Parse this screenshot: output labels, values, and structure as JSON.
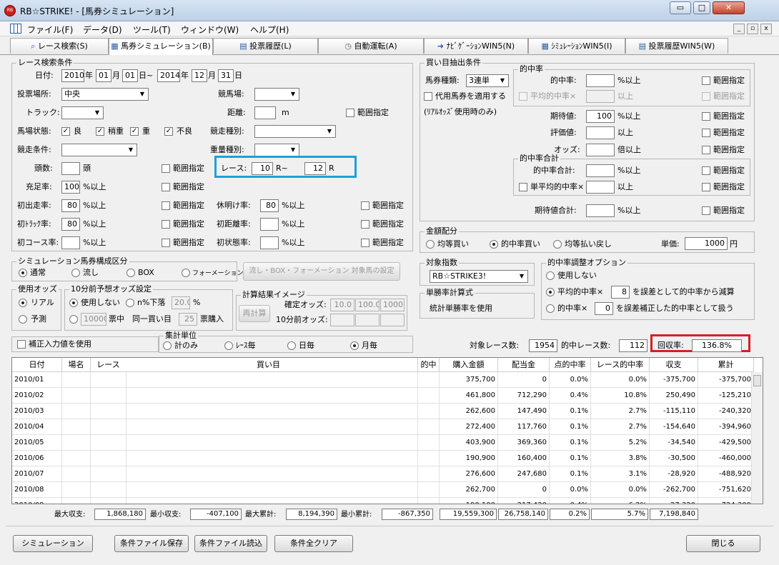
{
  "window": {
    "title": "RB☆STRIKE! - [馬券シミュレーション]",
    "minimize": "▭",
    "maximize": "□",
    "close": "✕",
    "app_icon": "RB"
  },
  "menu": {
    "items": [
      "ファイル(F)",
      "データ(D)",
      "ツール(T)",
      "ウィンドウ(W)",
      "ヘルプ(H)"
    ],
    "mdi": [
      "_",
      "▫",
      "x"
    ]
  },
  "tabs": [
    "レース検索(S)",
    "馬券シミュレーション(B)",
    "投票履歴(L)",
    "自動運転(A)",
    "ﾅﾋﾞｹﾞｰｼｮﾝWIN5(N)",
    "ｼﾐｭﾚｰｼｮﾝWIN5(I)",
    "投票履歴WIN5(W)"
  ],
  "race": {
    "group_title": "レース検索条件",
    "date_label": "日付:",
    "year1": "2010",
    "m1": "01",
    "d1": "01",
    "year2": "2014",
    "m2": "12",
    "d2": "31",
    "u_year": "年",
    "u_month": "月",
    "u_day_tilde": "日~",
    "u_day": "日",
    "venue_label": "投票場所:",
    "venue": "中央",
    "track_label": "競馬場:",
    "trackkind_label": "トラック:",
    "distance_label": "距離:",
    "distance_unit": "m",
    "range": "範囲指定",
    "cond_label": "馬場状態:",
    "c1": "良",
    "c2": "稍重",
    "c3": "重",
    "c4": "不良",
    "racetype_label": "競走種別:",
    "racecond_label": "競走条件:",
    "weight_label": "重量種別:",
    "count_label": "頭数:",
    "count_unit": "頭",
    "race_label": "レース:",
    "race_from": "10",
    "race_sep": "R~",
    "race_to": "12",
    "race_unit": "R",
    "fill_label": "充足率:",
    "fill_val": "100",
    "fill_unit": "%以上",
    "first_run_label": "初出走率:",
    "first_run_val": "80",
    "pct_over": "%以上",
    "rest_label": "休明け率:",
    "rest_val": "80",
    "first_track_label": "初ﾄﾗｯｸ率:",
    "first_track_val": "80",
    "first_dist_label": "初距離率:",
    "first_course_label": "初コース率:",
    "first_state_label": "初状態率:"
  },
  "sim": {
    "group_title": "シミュレーション馬券構成区分",
    "opts": [
      "通常",
      "流し",
      "BOX",
      "フォーメーション"
    ],
    "set_btn": "流し・BOX・フォーメーション 対象馬の設定"
  },
  "odds": {
    "group_title": "使用オッズ",
    "opts": [
      "リアル",
      "予測"
    ]
  },
  "pre10": {
    "group_title": "10分前予想オッズ設定",
    "opt1": "使用しない",
    "opt2": "n%下落",
    "pct": "20.0",
    "pct_unit": "%",
    "opt3_val": "10000",
    "opt3_a": "票中",
    "opt3_b": "同一買い目",
    "opt3_c": "25",
    "opt3_d": "票購入"
  },
  "calc": {
    "group_title": "計算結果イメージ",
    "btn": "再計算",
    "fixed_label": "確定オッズ:",
    "v1": "10.0",
    "v2": "100.0",
    "v3": "1000",
    "pre_label": "10分前オッズ:"
  },
  "correction": "補正入力値を使用",
  "agg": {
    "group_title": "集計単位",
    "opts": [
      "計のみ",
      "ﾚｰｽ毎",
      "日毎",
      "月毎"
    ]
  },
  "buy": {
    "group_title": "買い目抽出条件",
    "type_label": "馬券種類:",
    "type_val": "3連単",
    "sub_label": "代用馬券を適用する",
    "sub_note": "(ﾘｱﾙｵｯｽﾞ使用時のみ)",
    "hit_group": "的中率",
    "hit_label": "的中率:",
    "pct_over": "%以上",
    "range": "範囲指定",
    "avg_hit_label": "平均的中率×",
    "over": "以上",
    "exp_label": "期待値:",
    "exp_val": "100",
    "eval_label": "評価値:",
    "odds_label": "オッズ:",
    "odds_unit": "倍以上",
    "hit_sum_group": "的中率合計",
    "hit_sum_label": "的中率合計:",
    "single_avg_label": "単平均的中率×",
    "exp_sum_label": "期待値合計:"
  },
  "money": {
    "group_title": "金額配分",
    "opts": [
      "均等買い",
      "的中率買い",
      "均等払い戻し"
    ],
    "unit_label": "単価:",
    "unit_val": "1000",
    "yen": "円"
  },
  "index": {
    "group_title": "対象指数",
    "val": "RB☆STRIKE3!"
  },
  "single": {
    "group_title": "単勝率計算式",
    "text": "統計単勝率を使用"
  },
  "adjust": {
    "group_title": "的中率調整オプション",
    "opt1": "使用しない",
    "opt2a": "平均的中率×",
    "opt2_val": "8",
    "opt2b": "を誤差として的中率から減算",
    "opt3a": "的中率×",
    "opt3_val": "0",
    "opt3b": "を誤差補正した的中率として扱う"
  },
  "stats": {
    "target_label": "対象レース数:",
    "target": "1954",
    "hit_label": "的中レース数:",
    "hit": "112",
    "recovery_label": "回収率:",
    "recovery": "136.8%"
  },
  "table": {
    "headers": [
      "日付",
      "場名",
      "レース",
      "買い目",
      "的中",
      "購入金額",
      "配当金",
      "点的中率",
      "レース的中率",
      "収支",
      "累計"
    ],
    "rows": [
      [
        "2010/01",
        "",
        "",
        "",
        "",
        "375,700",
        "0",
        "0.0%",
        "0.0%",
        "-375,700",
        "-375,700"
      ],
      [
        "2010/02",
        "",
        "",
        "",
        "",
        "461,800",
        "712,290",
        "0.4%",
        "10.8%",
        "250,490",
        "-125,210"
      ],
      [
        "2010/03",
        "",
        "",
        "",
        "",
        "262,600",
        "147,490",
        "0.1%",
        "2.7%",
        "-115,110",
        "-240,320"
      ],
      [
        "2010/04",
        "",
        "",
        "",
        "",
        "272,400",
        "117,760",
        "0.1%",
        "2.7%",
        "-154,640",
        "-394,960"
      ],
      [
        "2010/05",
        "",
        "",
        "",
        "",
        "403,900",
        "369,360",
        "0.1%",
        "5.2%",
        "-34,540",
        "-429,500"
      ],
      [
        "2010/06",
        "",
        "",
        "",
        "",
        "190,900",
        "160,400",
        "0.1%",
        "3.8%",
        "-30,500",
        "-460,000"
      ],
      [
        "2010/07",
        "",
        "",
        "",
        "",
        "276,600",
        "247,680",
        "0.1%",
        "3.1%",
        "-28,920",
        "-488,920"
      ],
      [
        "2010/08",
        "",
        "",
        "",
        "",
        "262,700",
        "0",
        "0.0%",
        "0.0%",
        "-262,700",
        "-751,620"
      ],
      [
        "2010/09",
        "",
        "",
        "",
        "",
        "190,100",
        "217,420",
        "0.4%",
        "6.2%",
        "27,320",
        "-724,300"
      ]
    ]
  },
  "summary": {
    "max_label": "最大収支:",
    "max": "1,868,180",
    "min_label": "最小収支:",
    "min": "-407,100",
    "maxcum_label": "最大累計:",
    "maxcum": "8,194,390",
    "mincum_label": "最小累計:",
    "mincum": "-867,350",
    "buy": "19,559,300",
    "pay": "26,758,140",
    "pt": "0.2%",
    "race": "5.7%",
    "balance": "7,198,840"
  },
  "buttons": {
    "simulate": "シミュレーション",
    "save": "条件ファイル保存",
    "load": "条件ファイル読込",
    "clear": "条件全クリア",
    "close": "閉じる"
  }
}
